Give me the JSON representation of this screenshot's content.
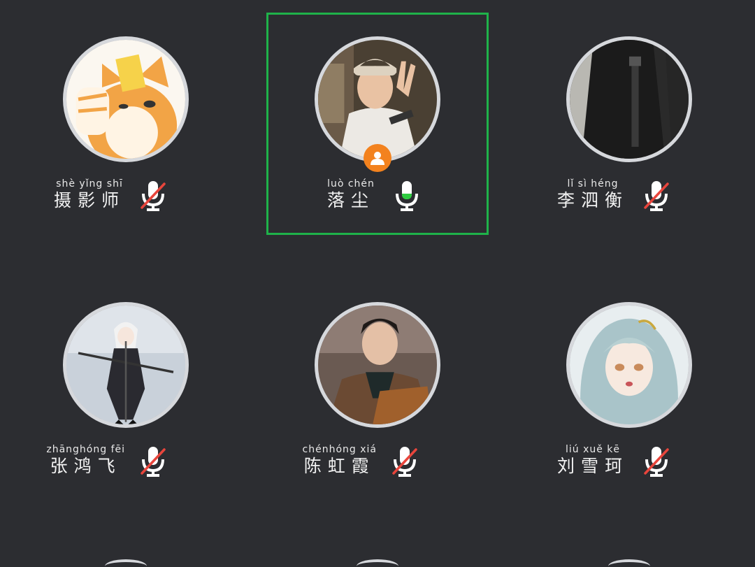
{
  "participants": [
    {
      "pinyin": "shè yǐng shī",
      "name": "摄影师",
      "mic": "muted",
      "host": false,
      "active": false,
      "avatar": "cartoon-cat-avatar"
    },
    {
      "pinyin": "luò chén",
      "name": "落尘",
      "mic": "speaking",
      "host": true,
      "active": true,
      "avatar": "young-man-peace-sign-avatar"
    },
    {
      "pinyin": "lǐ sì héng",
      "name": "李泗衡",
      "mic": "muted",
      "host": false,
      "active": false,
      "avatar": "guitar-dark-photo-avatar"
    },
    {
      "pinyin": "zhānghóng fēi",
      "name": "张鸿飞",
      "mic": "muted",
      "host": false,
      "active": false,
      "avatar": "anime-swordswoman-avatar"
    },
    {
      "pinyin": "chénhóng xiá",
      "name": "陈虹霞",
      "mic": "muted",
      "host": false,
      "active": false,
      "avatar": "man-brown-coat-avatar"
    },
    {
      "pinyin": "liú xuě kē",
      "name": "刘雪珂",
      "mic": "muted",
      "host": false,
      "active": false,
      "avatar": "anime-girl-avatar"
    }
  ],
  "colors": {
    "background": "#2c2d31",
    "active_border": "#1fb24a",
    "host_badge": "#f3821e",
    "mic_level": "#2ecc40",
    "mute_slash": "#e8453c"
  }
}
